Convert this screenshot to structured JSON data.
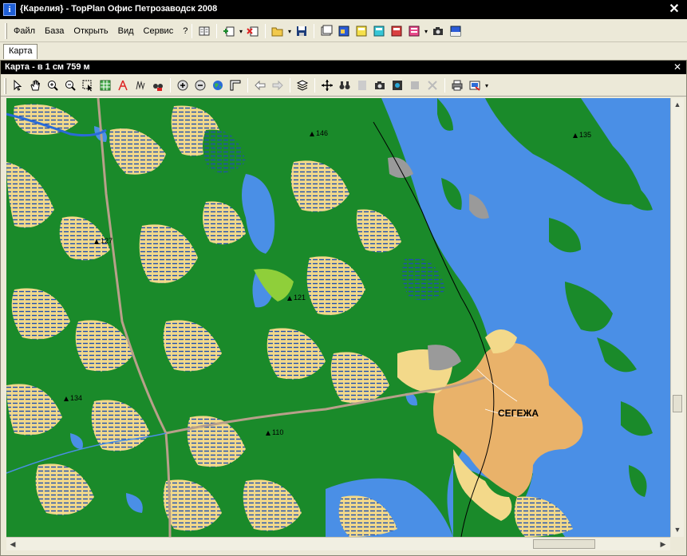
{
  "window": {
    "icon": "i",
    "title": "{Карелия} - TopPlan Офис Петрозаводск 2008",
    "close": "✕"
  },
  "menu": {
    "items": [
      "Файл",
      "База",
      "Открыть",
      "Вид",
      "Сервис",
      "?"
    ]
  },
  "main_toolbar": {
    "icons": [
      "book-icon",
      "add-layer-icon",
      "remove-layer-icon",
      "open-folder-icon",
      "save-icon",
      "window-icon",
      "map-layer-blue-icon",
      "map-layer-yellow-icon",
      "map-layer-cyan-icon",
      "map-layer-red-icon",
      "map-layer-list-icon",
      "camera-icon",
      "gps-icon"
    ]
  },
  "tabs": [
    "Карта"
  ],
  "map_window": {
    "title": "Карта - в 1 см 759 м",
    "close": "✕"
  },
  "map_toolbar": {
    "icons": [
      "pointer-icon",
      "hand-icon",
      "zoom-in-icon",
      "zoom-out-icon",
      "select-icon",
      "layer-grid-icon",
      "measure-icon",
      "track-icon",
      "binocular-layer-icon",
      "plus-circle-icon",
      "minus-circle-icon",
      "globe-icon",
      "ruler-icon",
      "back-arrow-icon",
      "forward-arrow-icon",
      "layers-icon",
      "center-icon",
      "binoculars-icon",
      "print-disabled-icon",
      "camera-icon",
      "photo-icon",
      "stop-disabled-icon",
      "cut-disabled-icon",
      "printer-icon",
      "export-icon"
    ]
  },
  "map": {
    "city": "СЕГЕЖА",
    "heights": [
      "146",
      "135",
      "127",
      "121",
      "134",
      "110"
    ],
    "colors": {
      "forest": "#1a8a2a",
      "water": "#4a8fe6",
      "clearing": "#f3d98a",
      "urban": "#e9b26a",
      "road": "#b8a08a",
      "industrial": "#9a9a9a"
    }
  },
  "scrollbars": {
    "up": "▲",
    "down": "▼",
    "left": "◀",
    "right": "▶"
  }
}
